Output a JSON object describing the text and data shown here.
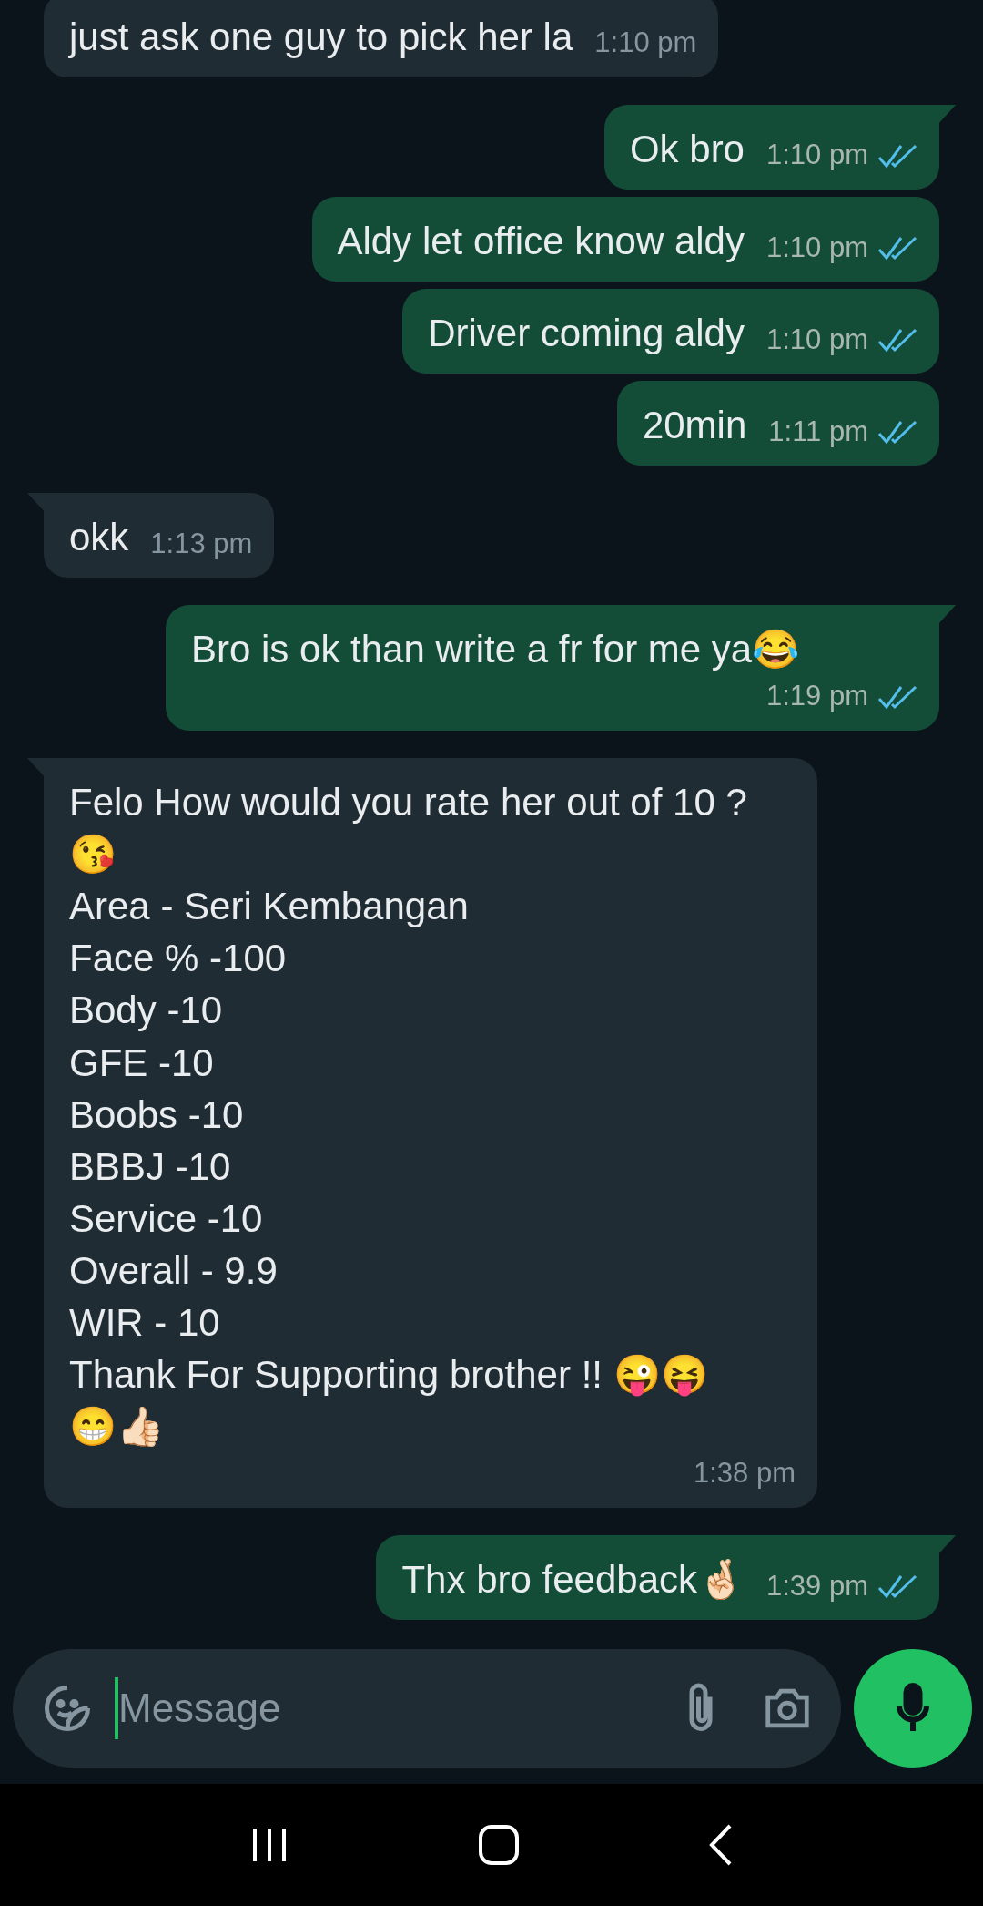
{
  "messages": [
    {
      "kind": "incoming",
      "tail": false,
      "text": "just ask one guy to pick her la",
      "time": "1:10 pm"
    },
    {
      "kind": "outgoing",
      "tail": true,
      "text": "Ok bro",
      "time": "1:10 pm",
      "read": true
    },
    {
      "kind": "outgoing",
      "tail": false,
      "text": "Aldy let office know aldy",
      "time": "1:10 pm",
      "read": true
    },
    {
      "kind": "outgoing",
      "tail": false,
      "text": "Driver coming aldy",
      "time": "1:10 pm",
      "read": true
    },
    {
      "kind": "outgoing",
      "tail": false,
      "text": "20min",
      "time": "1:11 pm",
      "read": true
    },
    {
      "kind": "incoming",
      "tail": true,
      "text": "okk",
      "time": "1:13 pm"
    },
    {
      "kind": "outgoing",
      "tail": true,
      "text": "Bro is ok than write a fr for me ya😂",
      "time": "1:19 pm",
      "read": true
    },
    {
      "kind": "incoming",
      "tail": true,
      "text": "Felo How would you rate her out of 10 ?\n😘\nArea - Seri Kembangan\nFace % -100\nBody -10\nGFE -10\nBoobs -10\nBBBJ -10\nService -10\nOverall - 9.9\nWIR - 10\nThank For Supporting brother !! 😜😝\n😁👍🏻",
      "time": "1:38 pm"
    },
    {
      "kind": "outgoing",
      "tail": true,
      "text": "Thx bro feedback🤞🏻",
      "time": "1:39 pm",
      "read": true
    }
  ],
  "composer": {
    "placeholder": "Message"
  }
}
